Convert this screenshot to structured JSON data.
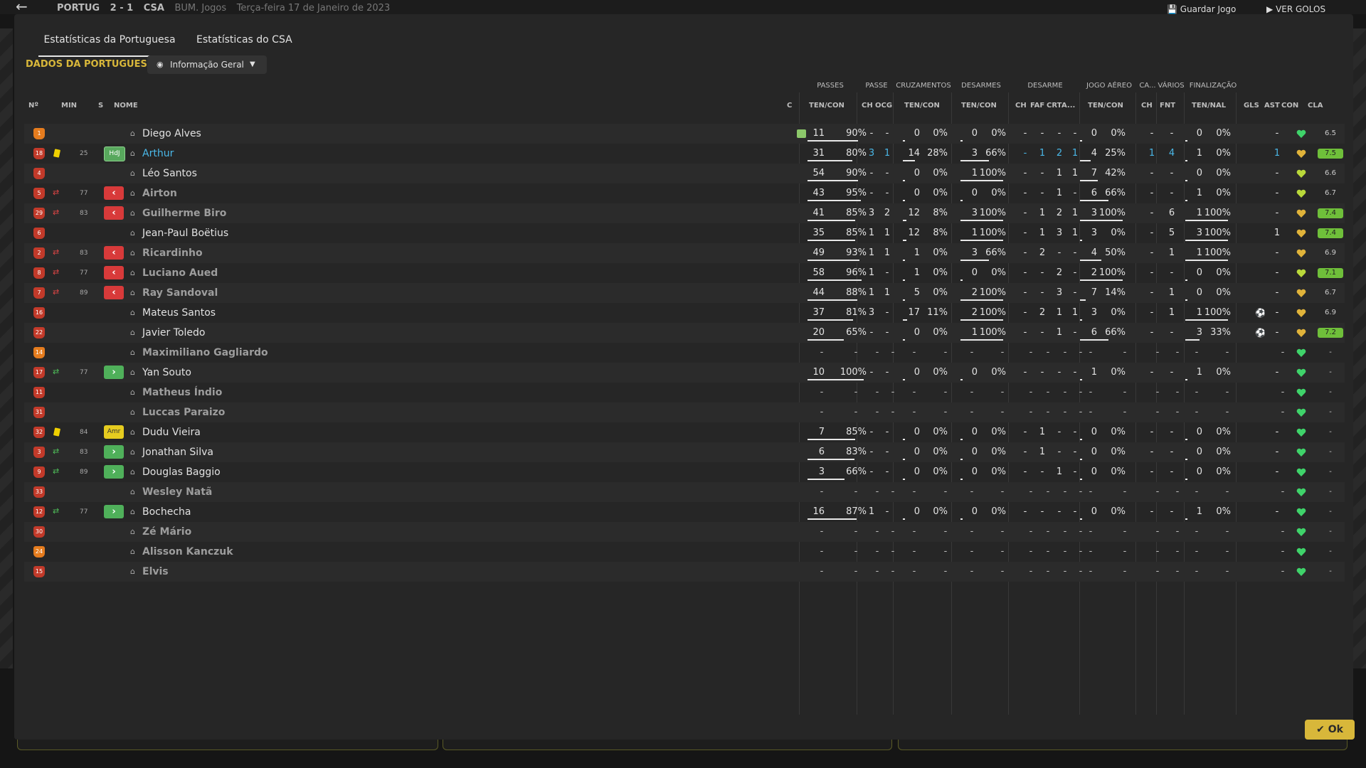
{
  "topbar": {
    "team_home": "PORTUG",
    "score": "2 - 1",
    "team_away": "CSA",
    "comp": "BUM. Jogos",
    "date": "Terça-feira 17 de Janeiro de 2023",
    "save_label": "Guardar Jogo",
    "goals_label": "VER GOLOS"
  },
  "tabs": [
    "Estatísticas da Portuguesa",
    "Estatísticas do CSA"
  ],
  "section_title": "DADOS DA PORTUGUESA",
  "view_select": {
    "label": "Informação Geral"
  },
  "groups": {
    "passes": "PASSES",
    "passe": "PASSE",
    "cruz": "CRUZAMENTOS",
    "desarmes": "DESARMES",
    "desarme": "DESARME",
    "jogo_aereo": "JOGO AÉREO",
    "ca": "CA...",
    "varios": "VÁRIOS",
    "finalizacao": "FINALIZAÇÃO"
  },
  "headers": {
    "no": "Nº",
    "min": "MIN",
    "s": "S",
    "nome": "NOME",
    "c": "C",
    "passes_tc": "TEN/CON",
    "ch": "CH",
    "ocg": "OCG",
    "cruz_tc": "TEN/CON",
    "des_tc": "TEN/CON",
    "dch": "CH",
    "faf": "FAF",
    "crt": "CRT",
    "a": "A...",
    "ja_tc": "TEN/CON",
    "cach": "CH",
    "fnt": "FNT",
    "fin_tn": "TEN/NAL",
    "gls": "GLS",
    "ast": "AST",
    "con": "CON",
    "cla": "CLA"
  },
  "ok_label": "Ok",
  "colors": {
    "accent": "#d8b73a",
    "sub_out": "#d83a3a",
    "sub_in": "#4fb05a",
    "rating_green": "#6fbf3a"
  },
  "players": [
    {
      "no": "1",
      "gk": true,
      "card": "",
      "sub": "",
      "min": "",
      "s": "",
      "name": "Diego Alves",
      "style": "",
      "c": true,
      "p": [
        "11",
        "90%"
      ],
      "pfrac": 0.9,
      "ch": "-",
      "ocg": "-",
      "cr": [
        "0",
        "0%"
      ],
      "crfrac": 0,
      "de": [
        "0",
        "0%"
      ],
      "defrac": 0,
      "dch": "-",
      "faf": "-",
      "crt": "-",
      "a": "-",
      "ja": [
        "0",
        "0%"
      ],
      "jafrac": 0,
      "cach": "-",
      "fnt": "-",
      "fi": [
        "0",
        "0%"
      ],
      "fifrac": 0,
      "gls": "",
      "ast": "-",
      "heart": "green",
      "cla": "6.5",
      "clag": false
    },
    {
      "no": "18",
      "gk": false,
      "card": "yellow",
      "sub": "",
      "min": "25",
      "s": "HdJ",
      "name": "Arthur",
      "style": "hl",
      "c": false,
      "p": [
        "31",
        "80%"
      ],
      "pfrac": 0.8,
      "ch": "3",
      "ocg": "1",
      "chb": true,
      "cr": [
        "14",
        "28%"
      ],
      "crfrac": 0.28,
      "de": [
        "3",
        "66%"
      ],
      "defrac": 0.66,
      "dch": "-",
      "faf": "1",
      "crt": "2",
      "a": "1",
      "db": true,
      "ja": [
        "4",
        "25%"
      ],
      "jafrac": 0.25,
      "cach": "1",
      "fnt": "4",
      "cab": true,
      "fi": [
        "1",
        "0%"
      ],
      "fifrac": 0,
      "gls": "",
      "ast": "1",
      "astb": true,
      "heart": "gold",
      "cla": "7.5",
      "clag": true
    },
    {
      "no": "4",
      "gk": false,
      "card": "",
      "sub": "",
      "min": "",
      "s": "",
      "name": "Léo Santos",
      "style": "",
      "c": false,
      "p": [
        "54",
        "90%"
      ],
      "pfrac": 0.9,
      "ch": "-",
      "ocg": "-",
      "cr": [
        "0",
        "0%"
      ],
      "crfrac": 0,
      "de": [
        "1",
        "100%"
      ],
      "defrac": 1,
      "dch": "-",
      "faf": "-",
      "crt": "1",
      "a": "1",
      "ja": [
        "7",
        "42%"
      ],
      "jafrac": 0.42,
      "cach": "-",
      "fnt": "-",
      "fi": [
        "0",
        "0%"
      ],
      "fifrac": 0,
      "gls": "",
      "ast": "-",
      "heart": "lime",
      "cla": "6.6",
      "clag": false
    },
    {
      "no": "5",
      "gk": false,
      "card": "",
      "sub": "out",
      "min": "77",
      "s": "out",
      "name": "Airton",
      "style": "sub",
      "c": false,
      "p": [
        "43",
        "95%"
      ],
      "pfrac": 0.95,
      "ch": "-",
      "ocg": "-",
      "cr": [
        "0",
        "0%"
      ],
      "crfrac": 0,
      "de": [
        "0",
        "0%"
      ],
      "defrac": 0,
      "dch": "-",
      "faf": "-",
      "crt": "1",
      "a": "-",
      "ja": [
        "6",
        "66%"
      ],
      "jafrac": 0.66,
      "cach": "-",
      "fnt": "-",
      "fi": [
        "1",
        "0%"
      ],
      "fifrac": 0,
      "gls": "",
      "ast": "-",
      "heart": "lime",
      "cla": "6.7",
      "clag": false
    },
    {
      "no": "29",
      "gk": false,
      "card": "",
      "sub": "out",
      "min": "83",
      "s": "out",
      "name": "Guilherme Biro",
      "style": "sub",
      "c": false,
      "p": [
        "41",
        "85%"
      ],
      "pfrac": 0.85,
      "ch": "3",
      "ocg": "2",
      "cr": [
        "12",
        "8%"
      ],
      "crfrac": 0.08,
      "de": [
        "3",
        "100%"
      ],
      "defrac": 1,
      "dch": "-",
      "faf": "1",
      "crt": "2",
      "a": "1",
      "ja": [
        "3",
        "100%"
      ],
      "jafrac": 1,
      "cach": "-",
      "fnt": "6",
      "fi": [
        "1",
        "100%"
      ],
      "fifrac": 1,
      "gls": "",
      "ast": "-",
      "heart": "gold",
      "cla": "7.4",
      "clag": true
    },
    {
      "no": "6",
      "gk": false,
      "card": "",
      "sub": "",
      "min": "",
      "s": "",
      "name": "Jean-Paul Boëtius",
      "style": "",
      "c": false,
      "p": [
        "35",
        "85%"
      ],
      "pfrac": 0.85,
      "ch": "1",
      "ocg": "1",
      "cr": [
        "12",
        "8%"
      ],
      "crfrac": 0.08,
      "de": [
        "1",
        "100%"
      ],
      "defrac": 1,
      "dch": "-",
      "faf": "1",
      "crt": "3",
      "a": "1",
      "ja": [
        "3",
        "0%"
      ],
      "jafrac": 0,
      "cach": "-",
      "fnt": "5",
      "fi": [
        "3",
        "100%"
      ],
      "fifrac": 1,
      "gls": "",
      "ast": "1",
      "heart": "gold",
      "cla": "7.4",
      "clag": true
    },
    {
      "no": "2",
      "gk": false,
      "card": "",
      "sub": "out",
      "min": "83",
      "s": "out",
      "name": "Ricardinho",
      "style": "sub",
      "c": false,
      "p": [
        "49",
        "93%"
      ],
      "pfrac": 0.93,
      "ch": "1",
      "ocg": "1",
      "cr": [
        "1",
        "0%"
      ],
      "crfrac": 0,
      "de": [
        "3",
        "66%"
      ],
      "defrac": 0.66,
      "dch": "-",
      "faf": "2",
      "crt": "-",
      "a": "-",
      "ja": [
        "4",
        "50%"
      ],
      "jafrac": 0.5,
      "cach": "-",
      "fnt": "1",
      "fi": [
        "1",
        "100%"
      ],
      "fifrac": 1,
      "gls": "",
      "ast": "-",
      "heart": "gold",
      "cla": "6.9",
      "clag": false
    },
    {
      "no": "8",
      "gk": false,
      "card": "",
      "sub": "out",
      "min": "77",
      "s": "out",
      "name": "Luciano Aued",
      "style": "sub",
      "c": false,
      "p": [
        "58",
        "96%"
      ],
      "pfrac": 0.96,
      "ch": "1",
      "ocg": "-",
      "cr": [
        "1",
        "0%"
      ],
      "crfrac": 0,
      "de": [
        "0",
        "0%"
      ],
      "defrac": 0,
      "dch": "-",
      "faf": "-",
      "crt": "2",
      "a": "-",
      "ja": [
        "2",
        "100%"
      ],
      "jafrac": 1,
      "cach": "-",
      "fnt": "-",
      "fi": [
        "0",
        "0%"
      ],
      "fifrac": 0,
      "gls": "",
      "ast": "-",
      "heart": "lime",
      "cla": "7.1",
      "clag": true
    },
    {
      "no": "7",
      "gk": false,
      "card": "",
      "sub": "out",
      "min": "89",
      "s": "out",
      "name": "Ray Sandoval",
      "style": "sub",
      "c": false,
      "p": [
        "44",
        "88%"
      ],
      "pfrac": 0.88,
      "ch": "1",
      "ocg": "1",
      "cr": [
        "5",
        "0%"
      ],
      "crfrac": 0,
      "de": [
        "2",
        "100%"
      ],
      "defrac": 1,
      "dch": "-",
      "faf": "-",
      "crt": "3",
      "a": "-",
      "ja": [
        "7",
        "14%"
      ],
      "jafrac": 0.14,
      "cach": "-",
      "fnt": "1",
      "fi": [
        "0",
        "0%"
      ],
      "fifrac": 0,
      "gls": "",
      "ast": "-",
      "heart": "gold",
      "cla": "6.7",
      "clag": false
    },
    {
      "no": "16",
      "gk": false,
      "card": "",
      "sub": "",
      "min": "",
      "s": "",
      "name": "Mateus Santos",
      "style": "",
      "c": false,
      "p": [
        "37",
        "81%"
      ],
      "pfrac": 0.81,
      "ch": "3",
      "ocg": "-",
      "cr": [
        "17",
        "11%"
      ],
      "crfrac": 0.11,
      "de": [
        "2",
        "100%"
      ],
      "defrac": 1,
      "dch": "-",
      "faf": "2",
      "crt": "1",
      "a": "1",
      "ja": [
        "3",
        "0%"
      ],
      "jafrac": 0,
      "cach": "-",
      "fnt": "1",
      "fi": [
        "1",
        "100%"
      ],
      "fifrac": 1,
      "gls": "ball",
      "ast": "-",
      "heart": "gold",
      "cla": "6.9",
      "clag": false
    },
    {
      "no": "22",
      "gk": false,
      "card": "",
      "sub": "",
      "min": "",
      "s": "",
      "name": "Javier Toledo",
      "style": "",
      "c": false,
      "p": [
        "20",
        "65%"
      ],
      "pfrac": 0.65,
      "ch": "-",
      "ocg": "-",
      "cr": [
        "0",
        "0%"
      ],
      "crfrac": 0,
      "de": [
        "1",
        "100%"
      ],
      "defrac": 1,
      "dch": "-",
      "faf": "-",
      "crt": "1",
      "a": "-",
      "ja": [
        "6",
        "66%"
      ],
      "jafrac": 0.66,
      "cach": "-",
      "fnt": "-",
      "fi": [
        "3",
        "33%"
      ],
      "fifrac": 0.33,
      "gls": "ball",
      "ast": "-",
      "heart": "gold",
      "cla": "7.2",
      "clag": true
    },
    {
      "no": "14",
      "gk": true,
      "card": "",
      "sub": "",
      "min": "",
      "s": "",
      "name": "Maximiliano Gagliardo",
      "style": "sub",
      "c": false,
      "empty": true,
      "heart": "green",
      "cla": "-",
      "clag": false
    },
    {
      "no": "17",
      "gk": false,
      "card": "",
      "sub": "in",
      "min": "77",
      "s": "in",
      "name": "Yan Souto",
      "style": "",
      "c": false,
      "p": [
        "10",
        "100%"
      ],
      "pfrac": 1,
      "ch": "-",
      "ocg": "-",
      "cr": [
        "0",
        "0%"
      ],
      "crfrac": 0,
      "de": [
        "0",
        "0%"
      ],
      "defrac": 0,
      "dch": "-",
      "faf": "-",
      "crt": "-",
      "a": "-",
      "ja": [
        "1",
        "0%"
      ],
      "jafrac": 0,
      "cach": "-",
      "fnt": "-",
      "fi": [
        "1",
        "0%"
      ],
      "fifrac": 0,
      "gls": "",
      "ast": "-",
      "heart": "green",
      "cla": "-",
      "clag": false
    },
    {
      "no": "11",
      "gk": false,
      "card": "",
      "sub": "",
      "min": "",
      "s": "",
      "name": "Matheus Índio",
      "style": "sub",
      "c": false,
      "empty": true,
      "heart": "green",
      "cla": "-",
      "clag": false
    },
    {
      "no": "31",
      "gk": false,
      "card": "",
      "sub": "",
      "min": "",
      "s": "",
      "name": "Luccas Paraizo",
      "style": "sub",
      "c": false,
      "empty": true,
      "heart": "green",
      "cla": "-",
      "clag": false
    },
    {
      "no": "32",
      "gk": false,
      "card": "yellow",
      "sub": "",
      "min": "84",
      "s": "Amr",
      "name": "Dudu Vieira",
      "style": "",
      "c": false,
      "p": [
        "7",
        "85%"
      ],
      "pfrac": 0.85,
      "ch": "-",
      "ocg": "-",
      "cr": [
        "0",
        "0%"
      ],
      "crfrac": 0,
      "de": [
        "0",
        "0%"
      ],
      "defrac": 0,
      "dch": "-",
      "faf": "1",
      "crt": "-",
      "a": "-",
      "ja": [
        "0",
        "0%"
      ],
      "jafrac": 0,
      "cach": "-",
      "fnt": "-",
      "fi": [
        "0",
        "0%"
      ],
      "fifrac": 0,
      "gls": "",
      "ast": "-",
      "heart": "green",
      "cla": "-",
      "clag": false
    },
    {
      "no": "3",
      "gk": false,
      "card": "",
      "sub": "in",
      "min": "83",
      "s": "in",
      "name": "Jonathan Silva",
      "style": "",
      "c": false,
      "p": [
        "6",
        "83%"
      ],
      "pfrac": 0.83,
      "ch": "-",
      "ocg": "-",
      "cr": [
        "0",
        "0%"
      ],
      "crfrac": 0,
      "de": [
        "0",
        "0%"
      ],
      "defrac": 0,
      "dch": "-",
      "faf": "1",
      "crt": "-",
      "a": "-",
      "ja": [
        "0",
        "0%"
      ],
      "jafrac": 0,
      "cach": "-",
      "fnt": "-",
      "fi": [
        "0",
        "0%"
      ],
      "fifrac": 0,
      "gls": "",
      "ast": "-",
      "heart": "green",
      "cla": "-",
      "clag": false
    },
    {
      "no": "9",
      "gk": false,
      "card": "",
      "sub": "in",
      "min": "89",
      "s": "in",
      "name": "Douglas Baggio",
      "style": "",
      "c": false,
      "p": [
        "3",
        "66%"
      ],
      "pfrac": 0.66,
      "ch": "-",
      "ocg": "-",
      "cr": [
        "0",
        "0%"
      ],
      "crfrac": 0,
      "de": [
        "0",
        "0%"
      ],
      "defrac": 0,
      "dch": "-",
      "faf": "-",
      "crt": "1",
      "a": "-",
      "ja": [
        "0",
        "0%"
      ],
      "jafrac": 0,
      "cach": "-",
      "fnt": "-",
      "fi": [
        "0",
        "0%"
      ],
      "fifrac": 0,
      "gls": "",
      "ast": "-",
      "heart": "green",
      "cla": "-",
      "clag": false
    },
    {
      "no": "33",
      "gk": false,
      "card": "",
      "sub": "",
      "min": "",
      "s": "",
      "name": "Wesley Natã",
      "style": "sub",
      "c": false,
      "empty": true,
      "heart": "green",
      "cla": "-",
      "clag": false
    },
    {
      "no": "12",
      "gk": false,
      "card": "",
      "sub": "in",
      "min": "77",
      "s": "in",
      "name": "Bochecha",
      "style": "",
      "c": false,
      "p": [
        "16",
        "87%"
      ],
      "pfrac": 0.87,
      "ch": "1",
      "ocg": "-",
      "cr": [
        "0",
        "0%"
      ],
      "crfrac": 0,
      "de": [
        "0",
        "0%"
      ],
      "defrac": 0,
      "dch": "-",
      "faf": "-",
      "crt": "-",
      "a": "-",
      "ja": [
        "0",
        "0%"
      ],
      "jafrac": 0,
      "cach": "-",
      "fnt": "-",
      "fi": [
        "1",
        "0%"
      ],
      "fifrac": 0,
      "gls": "",
      "ast": "-",
      "heart": "green",
      "cla": "-",
      "clag": false
    },
    {
      "no": "30",
      "gk": false,
      "card": "",
      "sub": "",
      "min": "",
      "s": "",
      "name": "Zé Mário",
      "style": "sub",
      "c": false,
      "empty": true,
      "heart": "green",
      "cla": "-",
      "clag": false
    },
    {
      "no": "24",
      "gk": true,
      "card": "",
      "sub": "",
      "min": "",
      "s": "",
      "name": "Alisson Kanczuk",
      "style": "sub",
      "c": false,
      "empty": true,
      "heart": "green",
      "cla": "-",
      "clag": false
    },
    {
      "no": "15",
      "gk": false,
      "card": "",
      "sub": "",
      "min": "",
      "s": "",
      "name": "Elvis",
      "style": "sub",
      "c": false,
      "empty": true,
      "heart": "green",
      "cla": "-",
      "clag": false
    }
  ]
}
